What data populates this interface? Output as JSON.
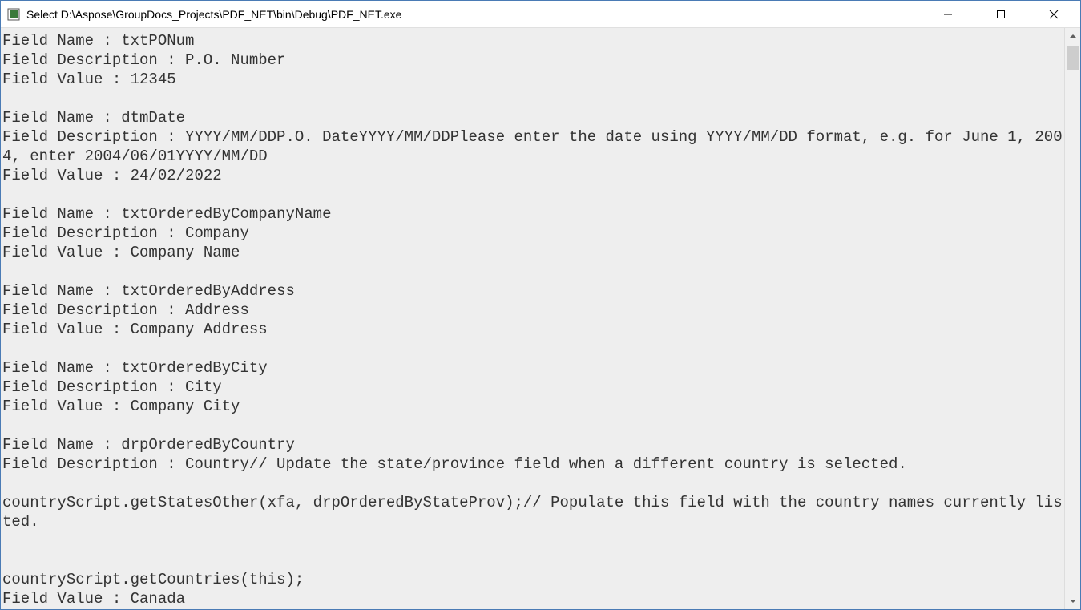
{
  "window": {
    "title": "Select D:\\Aspose\\GroupDocs_Projects\\PDF_NET\\bin\\Debug\\PDF_NET.exe"
  },
  "labels": {
    "field_name": "Field Name : ",
    "field_description": "Field Description : ",
    "field_value": "Field Value : "
  },
  "fields": [
    {
      "name": "txtPONum",
      "description": "P.O. Number",
      "value": "12345"
    },
    {
      "name": "dtmDate",
      "description": "YYYY/MM/DDP.O. DateYYYY/MM/DDPlease enter the date using YYYY/MM/DD format, e.g. for June 1, 2004, enter 2004/06/01YYYY/MM/DD",
      "value": "24/02/2022"
    },
    {
      "name": "txtOrderedByCompanyName",
      "description": "Company",
      "value": "Company Name"
    },
    {
      "name": "txtOrderedByAddress",
      "description": "Address",
      "value": "Company Address"
    },
    {
      "name": "txtOrderedByCity",
      "description": "City",
      "value": "Company City"
    },
    {
      "name": "drpOrderedByCountry",
      "description": "Country// Update the state/province field when a different country is selected.\n\ncountryScript.getStatesOther(xfa, drpOrderedByStateProv);// Populate this field with the country names currently listed.\n\n\ncountryScript.getCountries(this);",
      "value": "Canada"
    }
  ]
}
